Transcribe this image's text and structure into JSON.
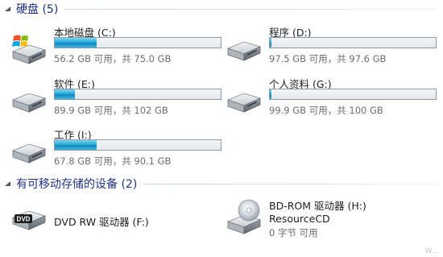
{
  "hard_drives_group": {
    "title": "硬盘 (5)",
    "drives": [
      {
        "name": "本地磁盘 (C:)",
        "space": "56.2 GB 可用，共 75.0 GB",
        "used_fraction": 0.25,
        "icon": "windows-system-drive-icon"
      },
      {
        "name": "程序 (D:)",
        "space": "97.5 GB 可用，共 97.6 GB",
        "used_fraction": 0.01,
        "icon": "hard-drive-icon"
      },
      {
        "name": "软件 (E:)",
        "space": "89.9 GB 可用，共 102 GB",
        "used_fraction": 0.12,
        "icon": "hard-drive-icon"
      },
      {
        "name": "个人资料 (G:)",
        "space": "99.9 GB 可用，共 100 GB",
        "used_fraction": 0.01,
        "icon": "hard-drive-icon"
      },
      {
        "name": "工作 (I:)",
        "space": "67.8 GB 可用，共 90.1 GB",
        "used_fraction": 0.25,
        "icon": "hard-drive-icon"
      }
    ]
  },
  "removable_group": {
    "title": "有可移动存储的设备 (2)",
    "devices": [
      {
        "name": "DVD RW 驱动器 (F:)",
        "icon": "dvd-drive-icon"
      },
      {
        "name": "BD-ROM 驱动器 (H:)",
        "label": "ResourceCD",
        "space": "0 字节 可用",
        "icon": "bd-rom-disc-icon"
      }
    ]
  },
  "watermark": "W...",
  "colors": {
    "accent": "#1e3287",
    "bar_fill": "#29a9d8"
  }
}
